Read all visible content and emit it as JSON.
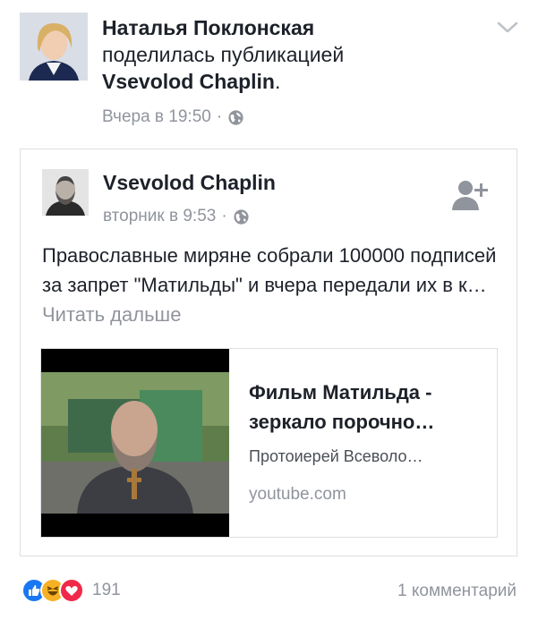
{
  "share": {
    "author": "Наталья Поклонская",
    "action_text": "поделилась публикацией",
    "target": "Vsevolod Chaplin",
    "target_suffix": ".",
    "time": "Вчера в 19:50",
    "separator": "·"
  },
  "post": {
    "author": "Vsevolod Chaplin",
    "time": "вторник в 9:53",
    "separator": "·",
    "text": "Православные миряне собрали 100000 подписей за запрет \"Матильды\" и вчера передали их в к…",
    "read_more": "Читать дальше"
  },
  "link": {
    "title_line1": "Фильм Матильда -",
    "title_line2": "зеркало порочно…",
    "description": "Протоиерей Всеволо…",
    "domain": "youtube.com"
  },
  "footer": {
    "reaction_count": "191",
    "comments": "1 комментарий",
    "reactions": [
      "like-icon",
      "haha-icon",
      "love-icon"
    ]
  },
  "colors": {
    "like": "#1877f2",
    "haha": "#f7b125",
    "love": "#f0284a",
    "muted": "#90949c",
    "text": "#1d2129"
  }
}
